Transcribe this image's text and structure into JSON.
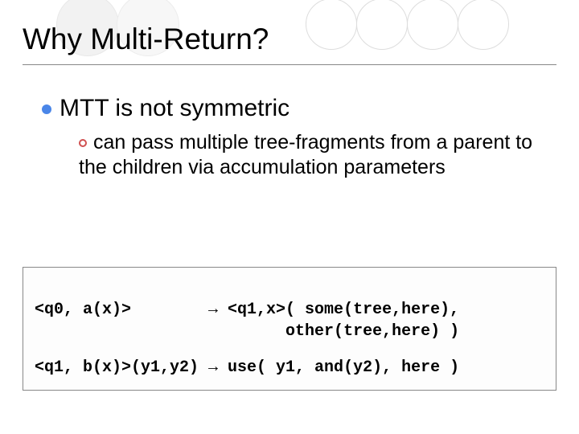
{
  "title": "Why Multi-Return?",
  "bullet1": "MTT is not symmetric",
  "bullet2_part1": "can pass multiple tree-fragments ",
  "bullet2_em": "from a parent to the children",
  "bullet2_part2": " via accumulation parameters",
  "code": {
    "line1a": "<q0, a(x)>        → <q1,x>( some(tree,here),",
    "line1b": "                          other(tree,here) )",
    "line2": "<q1, b(x)>(y1,y2) → use( y1, and(y2), here )"
  }
}
